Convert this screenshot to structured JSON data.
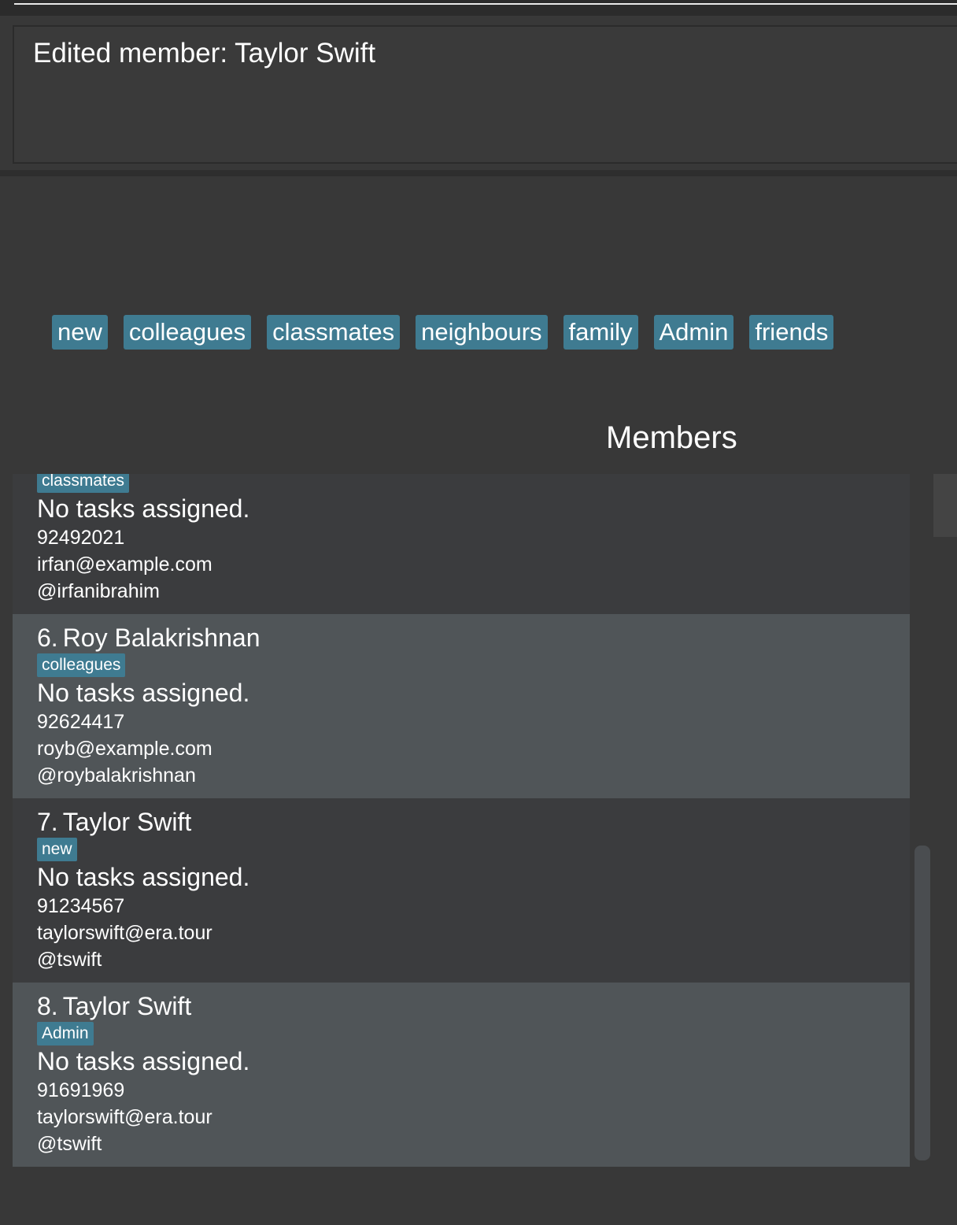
{
  "result": {
    "message": "Edited member: Taylor Swift"
  },
  "tags": [
    "new",
    "colleagues",
    "classmates",
    "neighbours",
    "family",
    "Admin",
    "friends"
  ],
  "members_panel": {
    "title": "Members",
    "cards": [
      {
        "index": "",
        "name": "",
        "tag": "classmates",
        "tasks": "No tasks assigned.",
        "phone": "92492021",
        "email": "irfan@example.com",
        "handle": "@irfanibrahim"
      },
      {
        "index": "6.",
        "name": "Roy Balakrishnan",
        "tag": "colleagues",
        "tasks": "No tasks assigned.",
        "phone": "92624417",
        "email": "royb@example.com",
        "handle": "@roybalakrishnan"
      },
      {
        "index": "7.",
        "name": "Taylor Swift",
        "tag": "new",
        "tasks": "No tasks assigned.",
        "phone": "91234567",
        "email": "taylorswift@era.tour",
        "handle": "@tswift"
      },
      {
        "index": "8.",
        "name": "Taylor Swift",
        "tag": "Admin",
        "tasks": "No tasks assigned.",
        "phone": "91691969",
        "email": "taylorswift@era.tour",
        "handle": "@tswift"
      }
    ]
  },
  "colors": {
    "background": "#383838",
    "card_dark": "#3b3c3e",
    "card_light": "#505558",
    "tag": "#3f7b91",
    "text": "#ffffff"
  }
}
